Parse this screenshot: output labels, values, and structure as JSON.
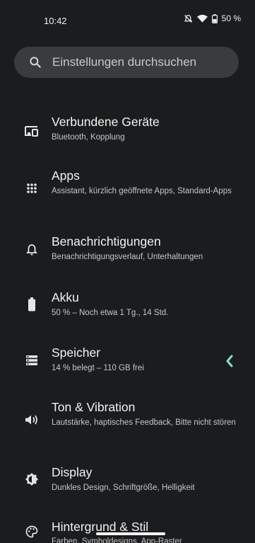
{
  "status": {
    "time": "10:42",
    "battery": "50 %",
    "icons": [
      "dnd-off-icon",
      "wifi-icon",
      "battery-icon"
    ]
  },
  "search": {
    "placeholder": "Einstellungen durchsuchen",
    "icon": "search-icon"
  },
  "items": [
    {
      "icon": "devices-icon",
      "title": "Verbundene Geräte",
      "sub": "Bluetooth, Kopplung"
    },
    {
      "icon": "apps-grid-icon",
      "title": "Apps",
      "sub": "Assistant, kürzlich geöffnete Apps, Standard-Apps"
    },
    {
      "icon": "bell-icon",
      "title": "Benachrichtigungen",
      "sub": "Benachrichtigungsverlauf, Unterhaltungen"
    },
    {
      "icon": "battery-full-icon",
      "title": "Akku",
      "sub": "50 % – Noch etwa 1 Tg., 14 Std."
    },
    {
      "icon": "storage-icon",
      "title": "Speicher",
      "sub": "14 % belegt – 110 GB frei"
    },
    {
      "icon": "volume-icon",
      "title": "Ton & Vibration",
      "sub": "Lautstärke, haptisches Feedback, Bitte nicht stören"
    },
    {
      "icon": "brightness-icon",
      "title": "Display",
      "sub": "Dunkles Design, Schriftgröße, Helligkeit"
    },
    {
      "icon": "palette-icon",
      "title": "Hintergrund & Stil",
      "sub": "Farben, Symboldesigns, App-Raster"
    }
  ],
  "colors": {
    "background": "#1b1c1e",
    "search_bg": "#3a3b3f",
    "accent": "#7fe0cf"
  }
}
